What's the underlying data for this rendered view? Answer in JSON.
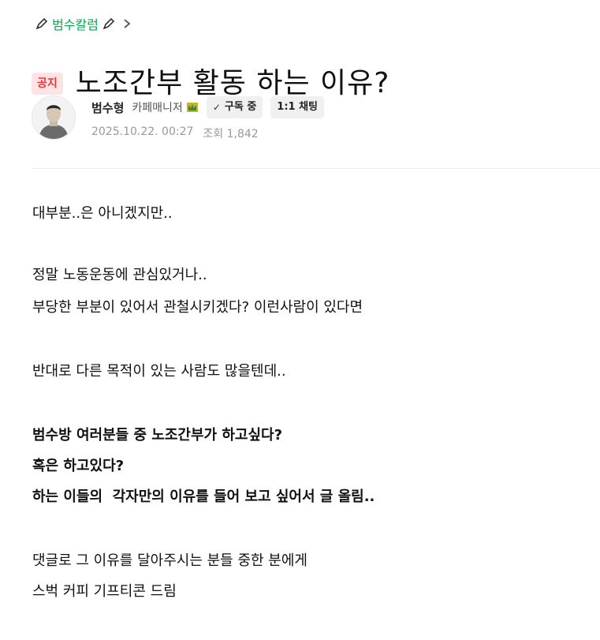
{
  "board": {
    "name": "범수칼럼",
    "pen_icon": "pencil-icon",
    "chevron_icon": "chevron-right-icon"
  },
  "post": {
    "badge": "공지",
    "title": "노조간부 활동 하는 이유?",
    "author": {
      "name": "범수형",
      "role": "카페매니저",
      "role_icon": "manager-badge-icon",
      "subscribe_label": "구독 중",
      "chat_label": "1:1 채팅"
    },
    "date": "2025.10.22. 00:27",
    "views_label": "조회 1,842"
  },
  "content": {
    "p1": "대부분..은 아니겠지만..",
    "p2": "정말 노동운동에 관심있거나..",
    "p3": "부당한 부분이 있어서 관철시키겠다? 이런사람이 있다면",
    "p4": "반대로 다른 목적이 있는 사람도 많을텐데..",
    "p5": "범수방 여러분들 중 노조간부가 하고싶다?",
    "p6": "혹은 하고있다?",
    "p7": "하는 이들의  각자만의 이유를 들어 보고 싶어서 글 올림..",
    "p8": "댓글로 그 이유를 달아주시는 분들 중한 분에게",
    "p9": "스벅 커피 기프티콘 드림"
  },
  "colors": {
    "board_link": "#03a94b",
    "badge_bg": "#fde3e3",
    "badge_text": "#e8363d",
    "meta": "#999999"
  }
}
